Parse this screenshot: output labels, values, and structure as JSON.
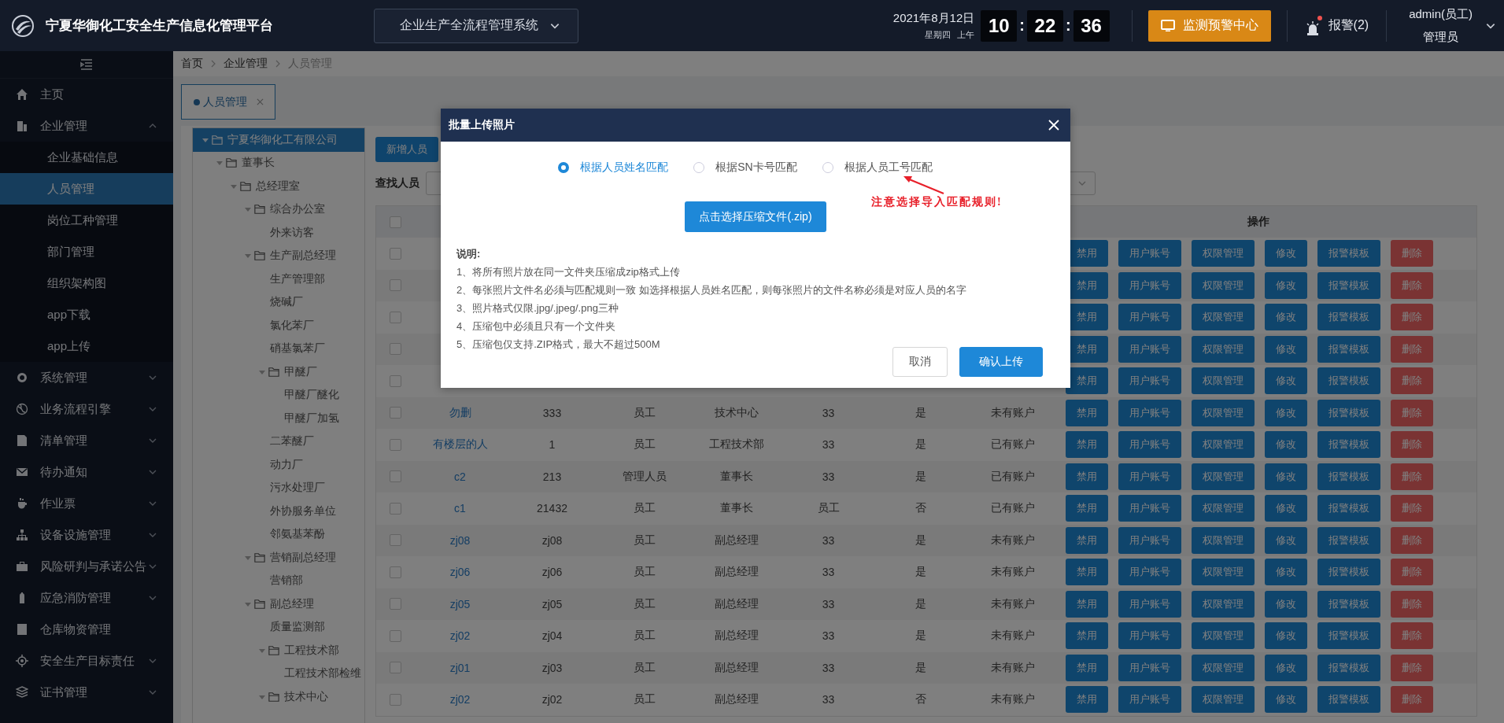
{
  "header": {
    "title": "宁夏华御化工安全生产信息化管理平台",
    "system_select": "企业生产全流程管理系统",
    "date": "2021年8月12日",
    "weekday": "星期四",
    "period": "上午",
    "clock": [
      {
        "text": "10",
        "kind": "digits"
      },
      {
        "text": ":",
        "kind": "separator"
      },
      {
        "text": "22",
        "kind": "digits"
      },
      {
        "text": ":",
        "kind": "separator"
      },
      {
        "text": "36",
        "kind": "digits"
      }
    ],
    "monitor_button": "监测预警中心",
    "alarm": {
      "label": "报警(2)",
      "unread": true
    },
    "user": {
      "name": "admin(员工)",
      "role": "管理员"
    }
  },
  "sidebar": {
    "items": [
      {
        "label": "主页",
        "kind": "link"
      },
      {
        "label": "企业管理",
        "kind": "group",
        "expanded": true,
        "children": [
          {
            "label": "企业基础信息",
            "selected": false
          },
          {
            "label": "人员管理",
            "selected": true
          },
          {
            "label": "岗位工种管理",
            "selected": false
          },
          {
            "label": "部门管理",
            "selected": false
          },
          {
            "label": "组织架构图",
            "selected": false
          },
          {
            "label": "app下载",
            "selected": false
          },
          {
            "label": "app上传",
            "selected": false
          }
        ]
      },
      {
        "label": "系统管理",
        "kind": "group",
        "expanded": false
      },
      {
        "label": "业务流程引擎",
        "kind": "group",
        "expanded": false
      },
      {
        "label": "清单管理",
        "kind": "group",
        "expanded": false
      },
      {
        "label": "待办通知",
        "kind": "group",
        "expanded": false
      },
      {
        "label": "作业票",
        "kind": "group",
        "expanded": false
      },
      {
        "label": "设备设施管理",
        "kind": "group",
        "expanded": false
      },
      {
        "label": "风险研判与承诺公告",
        "kind": "group",
        "expanded": false
      },
      {
        "label": "应急消防管理",
        "kind": "group",
        "expanded": false
      },
      {
        "label": "仓库物资管理",
        "kind": "link"
      },
      {
        "label": "安全生产目标责任",
        "kind": "group",
        "expanded": false
      },
      {
        "label": "证书管理",
        "kind": "group",
        "expanded": false
      }
    ]
  },
  "breadcrumb": [
    {
      "label": "首页",
      "current": false
    },
    {
      "label": "企业管理",
      "current": false
    },
    {
      "label": "人员管理",
      "current": true
    }
  ],
  "tabs": [
    {
      "label": "人员管理",
      "selected": true
    }
  ],
  "tree": [
    {
      "label": "宁夏华御化工有限公司",
      "kind": "folder",
      "expanded": true,
      "selected": true,
      "children": [
        {
          "label": "董事长",
          "kind": "folder",
          "expanded": true,
          "selected": false,
          "children": [
            {
              "label": "总经理室",
              "kind": "folder",
              "expanded": true,
              "selected": false,
              "children": [
                {
                  "label": "综合办公室",
                  "kind": "folder",
                  "expanded": true,
                  "selected": false,
                  "children": [
                    {
                      "label": "外来访客",
                      "kind": "leaf",
                      "selected": false
                    }
                  ]
                },
                {
                  "label": "生产副总经理",
                  "kind": "folder",
                  "expanded": true,
                  "selected": false,
                  "children": [
                    {
                      "label": "生产管理部",
                      "kind": "leaf",
                      "selected": false
                    },
                    {
                      "label": "烧碱厂",
                      "kind": "leaf",
                      "selected": false
                    },
                    {
                      "label": "氯化苯厂",
                      "kind": "leaf",
                      "selected": false
                    },
                    {
                      "label": "硝基氯苯厂",
                      "kind": "leaf",
                      "selected": false
                    },
                    {
                      "label": "甲醚厂",
                      "kind": "folder",
                      "expanded": true,
                      "selected": false,
                      "children": [
                        {
                          "label": "甲醚厂醚化",
                          "kind": "leaf",
                          "selected": false
                        },
                        {
                          "label": "甲醚厂加氢",
                          "kind": "leaf",
                          "selected": false
                        }
                      ]
                    },
                    {
                      "label": "二苯醚厂",
                      "kind": "leaf",
                      "selected": false
                    },
                    {
                      "label": "动力厂",
                      "kind": "leaf",
                      "selected": false
                    },
                    {
                      "label": "污水处理厂",
                      "kind": "leaf",
                      "selected": false
                    },
                    {
                      "label": "外协服务单位",
                      "kind": "leaf",
                      "selected": false
                    },
                    {
                      "label": "邻氨基苯酚",
                      "kind": "leaf",
                      "selected": false
                    }
                  ]
                },
                {
                  "label": "营销副总经理",
                  "kind": "folder",
                  "expanded": true,
                  "selected": false,
                  "children": [
                    {
                      "label": "营销部",
                      "kind": "leaf",
                      "selected": false
                    }
                  ]
                },
                {
                  "label": "副总经理",
                  "kind": "folder",
                  "expanded": true,
                  "selected": false,
                  "children": [
                    {
                      "label": "质量监测部",
                      "kind": "leaf",
                      "selected": false
                    },
                    {
                      "label": "工程技术部",
                      "kind": "folder",
                      "expanded": true,
                      "selected": false,
                      "children": [
                        {
                          "label": "工程技术部检维",
                          "kind": "leaf",
                          "selected": false
                        }
                      ]
                    },
                    {
                      "label": "技术中心",
                      "kind": "folder",
                      "expanded": true,
                      "selected": false
                    }
                  ]
                }
              ]
            }
          ]
        }
      ]
    }
  ],
  "toolbar": {
    "add_button": "新增人员",
    "search_label": "查找人员"
  },
  "table": {
    "header_checked": false,
    "action_column": "操作",
    "rows": [
      {
        "checked": false,
        "actions": [
          {
            "label": "禁用",
            "kind": "primary"
          },
          {
            "label": "用户账号",
            "kind": "primary"
          },
          {
            "label": "权限管理",
            "kind": "primary"
          },
          {
            "label": "修改",
            "kind": "primary"
          },
          {
            "label": "报警模板",
            "kind": "primary"
          },
          {
            "label": "删除",
            "kind": "danger"
          }
        ]
      },
      {
        "checked": false,
        "actions": [
          {
            "label": "禁用",
            "kind": "primary"
          },
          {
            "label": "用户账号",
            "kind": "primary"
          },
          {
            "label": "权限管理",
            "kind": "primary"
          },
          {
            "label": "修改",
            "kind": "primary"
          },
          {
            "label": "报警模板",
            "kind": "primary"
          },
          {
            "label": "删除",
            "kind": "danger"
          }
        ]
      },
      {
        "checked": false,
        "actions": [
          {
            "label": "禁用",
            "kind": "primary"
          },
          {
            "label": "用户账号",
            "kind": "primary"
          },
          {
            "label": "权限管理",
            "kind": "primary"
          },
          {
            "label": "修改",
            "kind": "primary"
          },
          {
            "label": "报警模板",
            "kind": "primary"
          },
          {
            "label": "删除",
            "kind": "danger"
          }
        ]
      },
      {
        "checked": false,
        "actions": [
          {
            "label": "禁用",
            "kind": "primary"
          },
          {
            "label": "用户账号",
            "kind": "primary"
          },
          {
            "label": "权限管理",
            "kind": "primary"
          },
          {
            "label": "修改",
            "kind": "primary"
          },
          {
            "label": "报警模板",
            "kind": "primary"
          },
          {
            "label": "删除",
            "kind": "danger"
          }
        ]
      },
      {
        "checked": false,
        "actions": [
          {
            "label": "禁用",
            "kind": "primary"
          },
          {
            "label": "用户账号",
            "kind": "primary"
          },
          {
            "label": "权限管理",
            "kind": "primary"
          },
          {
            "label": "修改",
            "kind": "primary"
          },
          {
            "label": "报警模板",
            "kind": "primary"
          },
          {
            "label": "删除",
            "kind": "danger"
          }
        ]
      },
      {
        "checked": false,
        "cells": [
          "勿删",
          "333",
          "员工",
          "技术中心",
          "33",
          "是",
          "未有账户"
        ],
        "actions": [
          {
            "label": "禁用",
            "kind": "primary"
          },
          {
            "label": "用户账号",
            "kind": "primary"
          },
          {
            "label": "权限管理",
            "kind": "primary"
          },
          {
            "label": "修改",
            "kind": "primary"
          },
          {
            "label": "报警模板",
            "kind": "primary"
          },
          {
            "label": "删除",
            "kind": "danger"
          }
        ]
      },
      {
        "checked": false,
        "cells": [
          "有楼层的人",
          "1",
          "员工",
          "工程技术部",
          "33",
          "是",
          "已有账户"
        ],
        "actions": [
          {
            "label": "禁用",
            "kind": "primary"
          },
          {
            "label": "用户账号",
            "kind": "primary"
          },
          {
            "label": "权限管理",
            "kind": "primary"
          },
          {
            "label": "修改",
            "kind": "primary"
          },
          {
            "label": "报警模板",
            "kind": "primary"
          },
          {
            "label": "删除",
            "kind": "danger"
          }
        ]
      },
      {
        "checked": false,
        "cells": [
          "c2",
          "213",
          "管理人员",
          "董事长",
          "33",
          "是",
          "已有账户"
        ],
        "actions": [
          {
            "label": "禁用",
            "kind": "primary"
          },
          {
            "label": "用户账号",
            "kind": "primary"
          },
          {
            "label": "权限管理",
            "kind": "primary"
          },
          {
            "label": "修改",
            "kind": "primary"
          },
          {
            "label": "报警模板",
            "kind": "primary"
          },
          {
            "label": "删除",
            "kind": "danger"
          }
        ]
      },
      {
        "checked": false,
        "cells": [
          "c1",
          "21432",
          "员工",
          "董事长",
          "员工",
          "否",
          "已有账户"
        ],
        "actions": [
          {
            "label": "禁用",
            "kind": "primary"
          },
          {
            "label": "用户账号",
            "kind": "primary"
          },
          {
            "label": "权限管理",
            "kind": "primary"
          },
          {
            "label": "修改",
            "kind": "primary"
          },
          {
            "label": "报警模板",
            "kind": "primary"
          },
          {
            "label": "删除",
            "kind": "danger"
          }
        ]
      },
      {
        "checked": false,
        "cells": [
          "zj08",
          "zj08",
          "员工",
          "副总经理",
          "33",
          "是",
          "未有账户"
        ],
        "actions": [
          {
            "label": "禁用",
            "kind": "primary"
          },
          {
            "label": "用户账号",
            "kind": "primary"
          },
          {
            "label": "权限管理",
            "kind": "primary"
          },
          {
            "label": "修改",
            "kind": "primary"
          },
          {
            "label": "报警模板",
            "kind": "primary"
          },
          {
            "label": "删除",
            "kind": "danger"
          }
        ]
      },
      {
        "checked": false,
        "cells": [
          "zj06",
          "zj06",
          "员工",
          "副总经理",
          "33",
          "是",
          "未有账户"
        ],
        "actions": [
          {
            "label": "禁用",
            "kind": "primary"
          },
          {
            "label": "用户账号",
            "kind": "primary"
          },
          {
            "label": "权限管理",
            "kind": "primary"
          },
          {
            "label": "修改",
            "kind": "primary"
          },
          {
            "label": "报警模板",
            "kind": "primary"
          },
          {
            "label": "删除",
            "kind": "danger"
          }
        ]
      },
      {
        "checked": false,
        "cells": [
          "zj05",
          "zj05",
          "员工",
          "副总经理",
          "33",
          "是",
          "未有账户"
        ],
        "actions": [
          {
            "label": "禁用",
            "kind": "primary"
          },
          {
            "label": "用户账号",
            "kind": "primary"
          },
          {
            "label": "权限管理",
            "kind": "primary"
          },
          {
            "label": "修改",
            "kind": "primary"
          },
          {
            "label": "报警模板",
            "kind": "primary"
          },
          {
            "label": "删除",
            "kind": "danger"
          }
        ]
      },
      {
        "checked": false,
        "cells": [
          "zj02",
          "zj04",
          "员工",
          "副总经理",
          "33",
          "是",
          "未有账户"
        ],
        "actions": [
          {
            "label": "禁用",
            "kind": "primary"
          },
          {
            "label": "用户账号",
            "kind": "primary"
          },
          {
            "label": "权限管理",
            "kind": "primary"
          },
          {
            "label": "修改",
            "kind": "primary"
          },
          {
            "label": "报警模板",
            "kind": "primary"
          },
          {
            "label": "删除",
            "kind": "danger"
          }
        ]
      },
      {
        "checked": false,
        "cells": [
          "zj01",
          "zj03",
          "员工",
          "副总经理",
          "33",
          "是",
          "未有账户"
        ],
        "actions": [
          {
            "label": "禁用",
            "kind": "primary"
          },
          {
            "label": "用户账号",
            "kind": "primary"
          },
          {
            "label": "权限管理",
            "kind": "primary"
          },
          {
            "label": "修改",
            "kind": "primary"
          },
          {
            "label": "报警模板",
            "kind": "primary"
          },
          {
            "label": "删除",
            "kind": "danger"
          }
        ]
      },
      {
        "checked": false,
        "cells": [
          "zj02",
          "zj02",
          "员工",
          "副总经理",
          "33",
          "否",
          "未有账户"
        ],
        "actions": [
          {
            "label": "禁用",
            "kind": "primary"
          },
          {
            "label": "用户账号",
            "kind": "primary"
          },
          {
            "label": "权限管理",
            "kind": "primary"
          },
          {
            "label": "修改",
            "kind": "primary"
          },
          {
            "label": "报警模板",
            "kind": "primary"
          },
          {
            "label": "删除",
            "kind": "danger"
          }
        ]
      }
    ]
  },
  "dialog": {
    "title": "批量上传照片",
    "match_rules": [
      {
        "label": "根据人员姓名匹配",
        "selected": true
      },
      {
        "label": "根据SN卡号匹配",
        "selected": false
      },
      {
        "label": "根据人员工号匹配",
        "selected": false
      }
    ],
    "annotation": "注意选择导入匹配规则!",
    "file_button": "点击选择压缩文件(.zip)",
    "notes_title": "说明:",
    "notes": [
      "1、将所有照片放在同一文件夹压缩成zip格式上传",
      "2、每张照片文件名必须与匹配规则一致 如选择根据人员姓名匹配，则每张照片的文件名称必须是对应人员的名字",
      "3、照片格式仅限.jpg/.jpeg/.png三种",
      "4、压缩包中必须且只有一个文件夹",
      "5、压缩包仅支持.ZIP格式，最大不超过500M"
    ],
    "buttons": [
      {
        "label": "取消",
        "kind": "default"
      },
      {
        "label": "确认上传",
        "kind": "primary"
      }
    ]
  }
}
